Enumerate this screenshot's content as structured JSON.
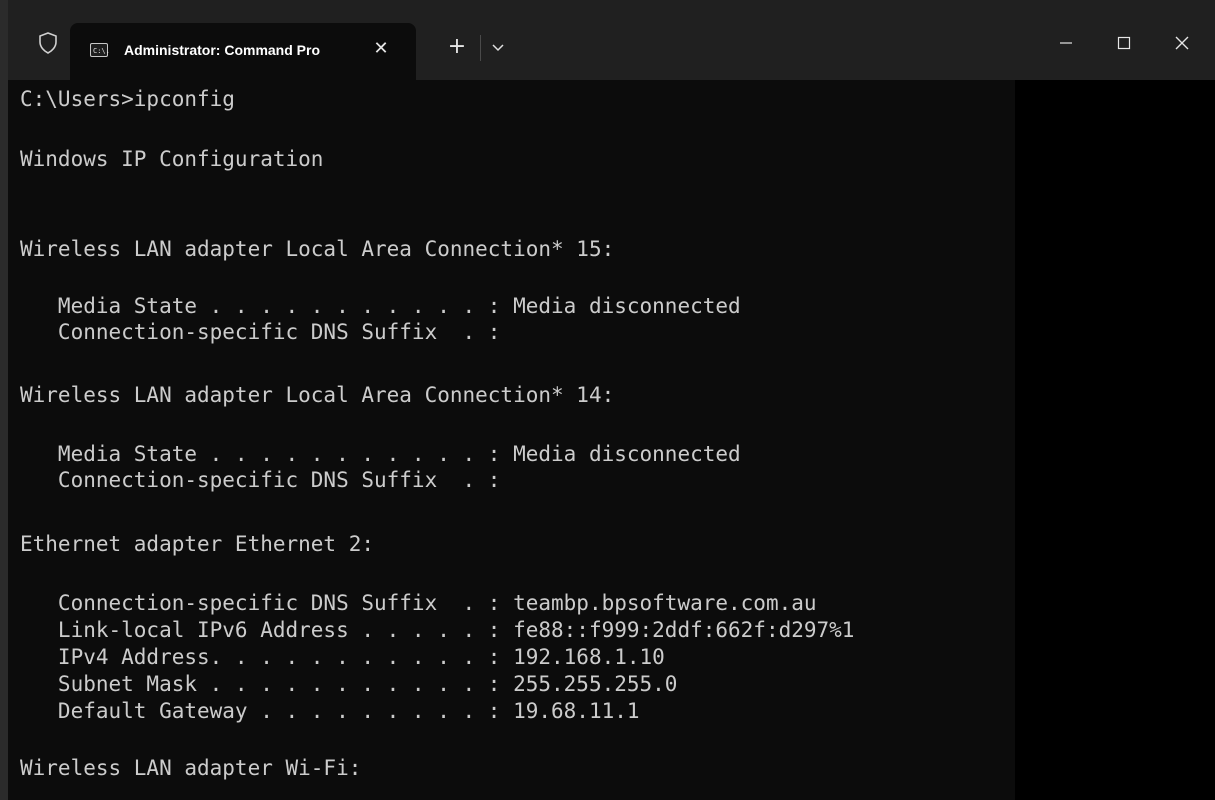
{
  "window": {
    "tab_title": "Administrator: Command Pro",
    "tab_icon_text": "C:\\.",
    "close_glyph": "✕",
    "new_tab_glyph": "+",
    "icons": {
      "shield": "shield-icon",
      "terminal": "command-prompt-icon",
      "dropdown": "chevron-down-icon",
      "minimize": "minimize-icon",
      "maximize": "maximize-icon",
      "close": "close-icon"
    }
  },
  "colors": {
    "titlebar": "#202020",
    "terminal_bg": "#0c0c0c",
    "terminal_text": "#cccccc"
  },
  "terminal": {
    "lines": [
      "C:\\Users>ipconfig",
      "",
      "Windows IP Configuration",
      "",
      "",
      "Wireless LAN adapter Local Area Connection* 15:",
      "",
      "   Media State . . . . . . . . . . . : Media disconnected",
      "   Connection-specific DNS Suffix  . :",
      "",
      "Wireless LAN adapter Local Area Connection* 14:",
      "",
      "   Media State . . . . . . . . . . . : Media disconnected",
      "   Connection-specific DNS Suffix  . :",
      "",
      "Ethernet adapter Ethernet 2:",
      "",
      "   Connection-specific DNS Suffix  . : teambp.bpsoftware.com.au",
      "   Link-local IPv6 Address . . . . . : fe88::f999:2ddf:662f:d297%1",
      "   IPv4 Address. . . . . . . . . . . : 192.168.1.10",
      "   Subnet Mask . . . . . . . . . . . : 255.255.255.0",
      "   Default Gateway . . . . . . . . . : 19.68.11.1",
      "",
      "Wireless LAN adapter Wi-Fi:"
    ]
  }
}
